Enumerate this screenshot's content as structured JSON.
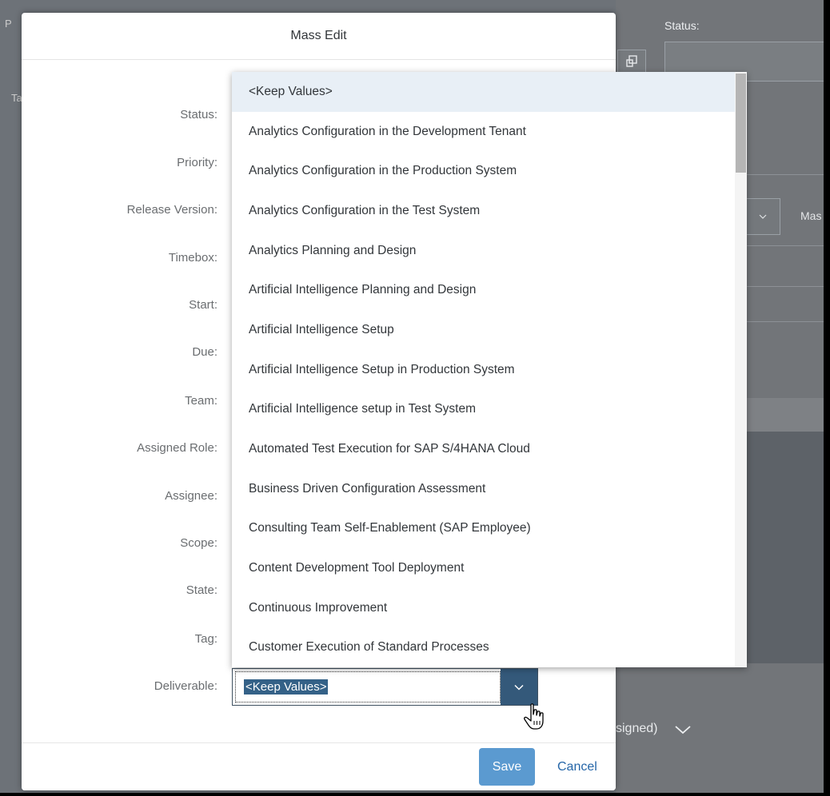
{
  "background": {
    "status_label": "Status:",
    "mas_text": "Mas",
    "signed_text": "signed)",
    "left_fragment_1": "P",
    "left_fragment_2": "Ta"
  },
  "dialog": {
    "title": "Mass Edit",
    "labels": {
      "status": "Status:",
      "priority": "Priority:",
      "release_version": "Release Version:",
      "timebox": "Timebox:",
      "start": "Start:",
      "due": "Due:",
      "team": "Team:",
      "assigned_role": "Assigned Role:",
      "assignee": "Assignee:",
      "scope": "Scope:",
      "state": "State:",
      "tag": "Tag:",
      "deliverable": "Deliverable:"
    },
    "deliverable_value": "<Keep Values>",
    "save_label": "Save",
    "cancel_label": "Cancel"
  },
  "dropdown": {
    "items": [
      "<Keep Values>",
      "Analytics Configuration in the Development Tenant",
      "Analytics Configuration in the Production System",
      "Analytics Configuration in the Test System",
      "Analytics Planning and Design",
      "Artificial Intelligence Planning and Design",
      "Artificial Intelligence Setup",
      "Artificial Intelligence Setup in Production System",
      "Artificial Intelligence setup in Test System",
      "Automated Test Execution for SAP S/4HANA Cloud",
      "Business Driven Configuration Assessment",
      "Consulting Team Self-Enablement (SAP Employee)",
      "Content Development Tool Deployment",
      "Continuous Improvement",
      "Customer Execution of Standard Processes"
    ],
    "selected_index": 0
  },
  "colors": {
    "accent": "#34597a",
    "save_button": "#5b9ad0",
    "link": "#2566a8"
  }
}
